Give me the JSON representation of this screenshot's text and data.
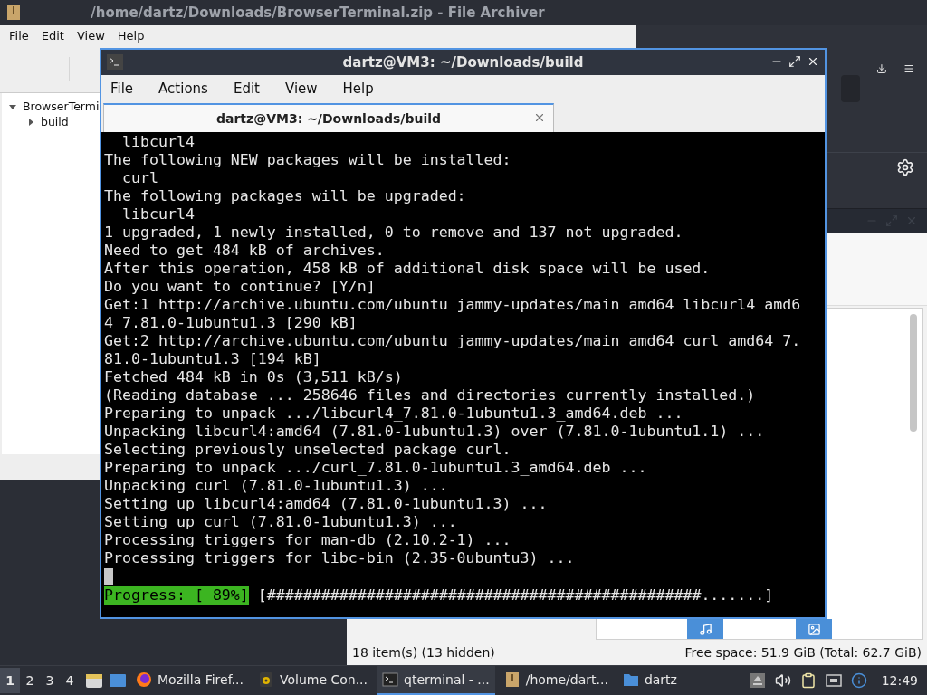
{
  "archiver": {
    "title": "/home/dartz/Downloads/BrowserTerminal.zip - File Archiver",
    "menu": [
      "File",
      "Edit",
      "View",
      "Help"
    ],
    "tree": [
      {
        "label": "BrowserTermi",
        "expanded": true,
        "children": [
          {
            "label": "build",
            "expanded": false
          }
        ]
      }
    ]
  },
  "file_manager": {
    "status_left": "18 item(s) (13 hidden)",
    "status_right": "Free space: 51.9 GiB (Total: 62.7 GiB)"
  },
  "terminal": {
    "title": "dartz@VM3: ~/Downloads/build",
    "menu": [
      "File",
      "Actions",
      "Edit",
      "View",
      "Help"
    ],
    "tabs": [
      {
        "label": "dartz@VM3: ~/Downloads/build",
        "selected": true
      }
    ],
    "lines": [
      "  libcurl4",
      "The following NEW packages will be installed:",
      "  curl",
      "The following packages will be upgraded:",
      "  libcurl4",
      "1 upgraded, 1 newly installed, 0 to remove and 137 not upgraded.",
      "Need to get 484 kB of archives.",
      "After this operation, 458 kB of additional disk space will be used.",
      "Do you want to continue? [Y/n]",
      "Get:1 http://archive.ubuntu.com/ubuntu jammy-updates/main amd64 libcurl4 amd6",
      "4 7.81.0-1ubuntu1.3 [290 kB]",
      "Get:2 http://archive.ubuntu.com/ubuntu jammy-updates/main amd64 curl amd64 7.",
      "81.0-1ubuntu1.3 [194 kB]",
      "Fetched 484 kB in 0s (3,511 kB/s)",
      "(Reading database ... 258646 files and directories currently installed.)",
      "Preparing to unpack .../libcurl4_7.81.0-1ubuntu1.3_amd64.deb ...",
      "Unpacking libcurl4:amd64 (7.81.0-1ubuntu1.3) over (7.81.0-1ubuntu1.1) ...",
      "Selecting previously unselected package curl.",
      "Preparing to unpack .../curl_7.81.0-1ubuntu1.3_amd64.deb ...",
      "Unpacking curl (7.81.0-1ubuntu1.3) ...",
      "Setting up libcurl4:amd64 (7.81.0-1ubuntu1.3) ...",
      "Setting up curl (7.81.0-1ubuntu1.3) ...",
      "Processing triggers for man-db (2.10.2-1) ...",
      "Processing triggers for libc-bin (2.35-0ubuntu3) ..."
    ],
    "progress": {
      "label": "Progress: [ 89%]",
      "bar": "[################################################.......]"
    }
  },
  "taskbar": {
    "workspaces": [
      {
        "label": "1",
        "selected": true
      },
      {
        "label": "2",
        "selected": false
      },
      {
        "label": "3",
        "selected": false
      },
      {
        "label": "4",
        "selected": false
      }
    ],
    "tasks": [
      {
        "label": "Mozilla Firef...",
        "kind": "browser",
        "active": false
      },
      {
        "label": "Volume Con...",
        "kind": "volume",
        "active": false
      },
      {
        "label": "qterminal - ...",
        "kind": "terminal",
        "active": true
      },
      {
        "label": "/home/dart...",
        "kind": "archive",
        "active": false
      },
      {
        "label": "dartz",
        "kind": "folder",
        "active": false
      }
    ],
    "clock": "12:49"
  }
}
